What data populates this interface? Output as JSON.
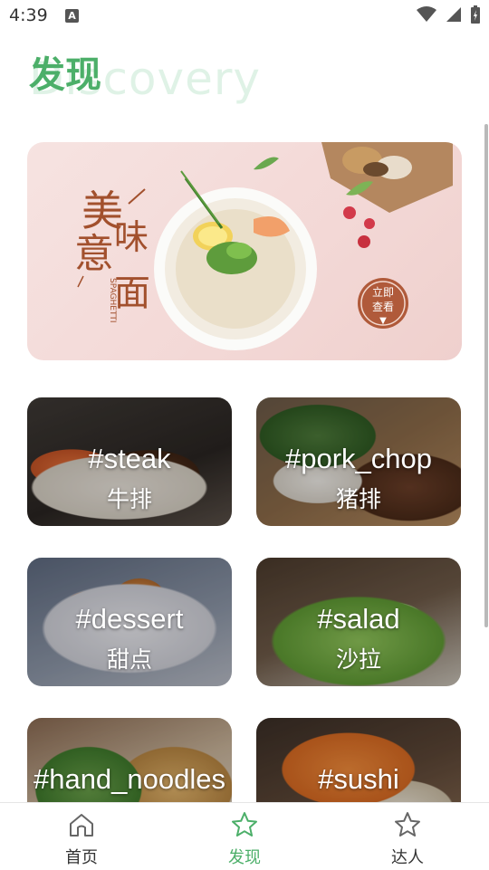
{
  "status": {
    "time": "4:39",
    "notification_badge": "A"
  },
  "header": {
    "title": "发现",
    "watermark": "Discovery"
  },
  "banner": {
    "headline_1": "美味",
    "headline_2": "意面",
    "sub_text": "SPAGHETTI",
    "cta_line_1": "立即",
    "cta_line_2": "查看",
    "cta_arrow": "▼"
  },
  "categories": [
    {
      "tag": "#steak",
      "name": "牛排"
    },
    {
      "tag": "#pork_chop",
      "name": "猪排"
    },
    {
      "tag": "#dessert",
      "name": "甜点"
    },
    {
      "tag": "#salad",
      "name": "沙拉"
    },
    {
      "tag": "#hand_noodles",
      "name": ""
    },
    {
      "tag": "#sushi",
      "name": ""
    }
  ],
  "nav": [
    {
      "label": "首页",
      "icon": "home-icon"
    },
    {
      "label": "发现",
      "icon": "star-icon",
      "active": true
    },
    {
      "label": "达人",
      "icon": "star-icon"
    }
  ],
  "colors": {
    "accent": "#4caf69",
    "watermark": "#dff2e6"
  }
}
